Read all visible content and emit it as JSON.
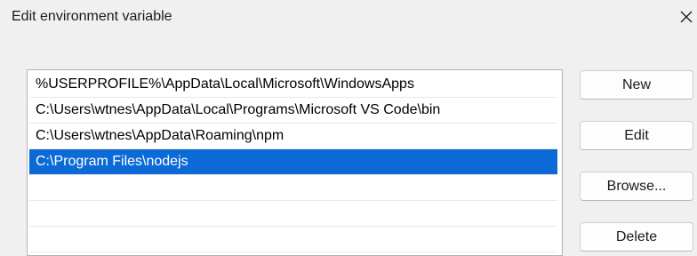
{
  "window": {
    "title": "Edit environment variable",
    "close_icon": "close-icon"
  },
  "paths": [
    {
      "value": "%USERPROFILE%\\AppData\\Local\\Microsoft\\WindowsApps",
      "selected": false
    },
    {
      "value": "C:\\Users\\wtnes\\AppData\\Local\\Programs\\Microsoft VS Code\\bin",
      "selected": false
    },
    {
      "value": "C:\\Users\\wtnes\\AppData\\Roaming\\npm",
      "selected": false
    },
    {
      "value": "C:\\Program Files\\nodejs",
      "selected": true
    },
    {
      "value": "",
      "selected": false
    },
    {
      "value": "",
      "selected": false
    },
    {
      "value": "",
      "selected": false
    }
  ],
  "buttons": {
    "new_label": "New",
    "edit_label": "Edit",
    "browse_label": "Browse...",
    "delete_label": "Delete"
  },
  "colors": {
    "selection": "#0c6ad6",
    "selection_text": "#ffffff"
  }
}
